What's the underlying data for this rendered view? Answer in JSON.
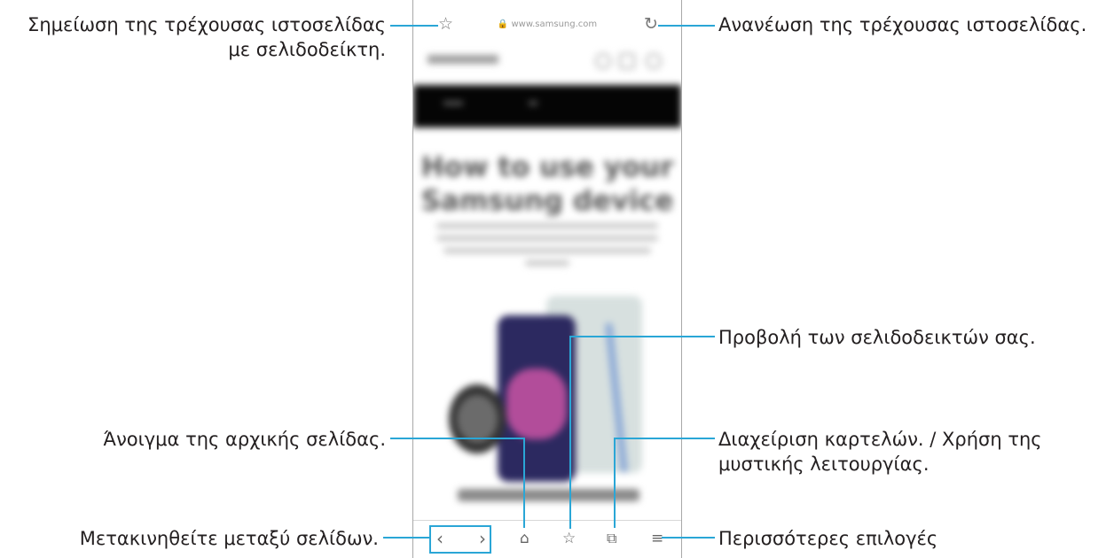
{
  "callouts": {
    "bookmark_current_line1": "Σημείωση της τρέχουσας ιστοσελίδας",
    "bookmark_current_line2": "με σελιδοδείκτη.",
    "refresh": "Ανανέωση της τρέχουσας ιστοσελίδας.",
    "view_bookmarks": "Προβολή των σελιδοδεικτών σας.",
    "home": "Άνοιγμα της αρχικής σελίδας.",
    "tabs_line1": "Διαχείριση καρτελών. / Χρήση της",
    "tabs_line2": "μυστικής λειτουργίας.",
    "navigate": "Μετακινηθείτε μεταξύ σελίδων.",
    "more": "Περισσότερες επιλογές"
  },
  "browser": {
    "url": "🔒 www.samsung.com",
    "headline_line1": "How to use your",
    "headline_line2": "Samsung device"
  },
  "icons": {
    "bookmark": "star-outline-icon",
    "refresh": "refresh-icon",
    "back": "chevron-left-icon",
    "forward": "chevron-right-icon",
    "home": "home-icon",
    "bookmarks": "bookmarks-icon",
    "tabs": "tabs-icon",
    "menu": "menu-icon"
  },
  "colors": {
    "leader": "#2aa6d6"
  }
}
